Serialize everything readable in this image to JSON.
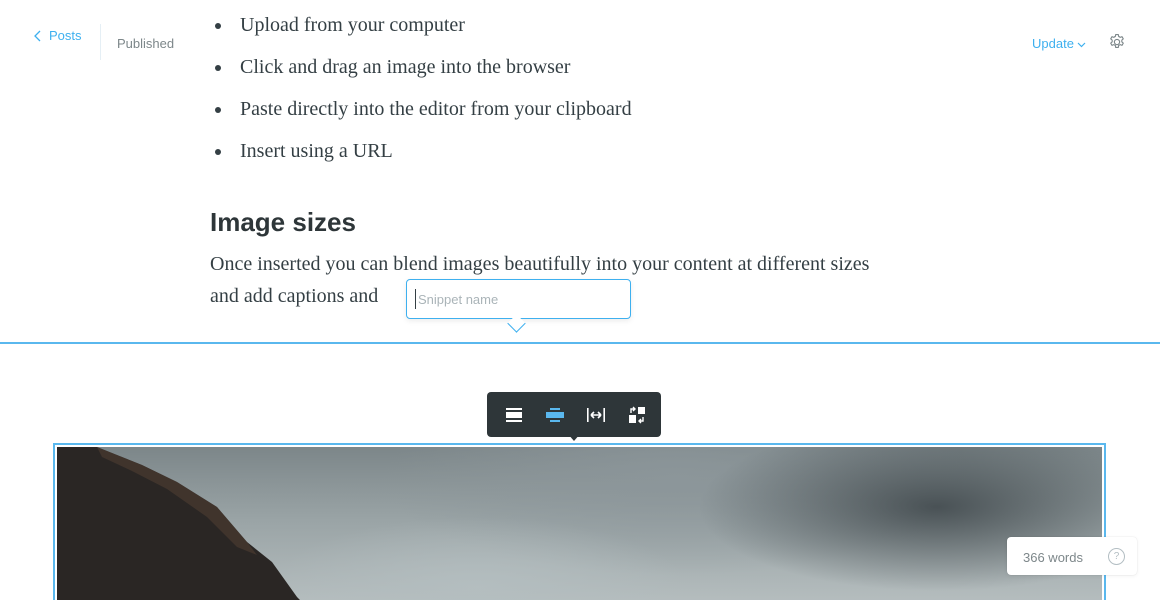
{
  "header": {
    "back_label": "Posts",
    "status": "Published",
    "update_label": "Update"
  },
  "editor": {
    "bullets": [
      "Upload from your computer",
      "Click and drag an image into the browser",
      "Paste directly into the editor from your clipboard",
      "Insert using a URL"
    ],
    "heading": "Image sizes",
    "paragraph_line1": "Once inserted you can blend images beautifully into your content at different sizes",
    "paragraph_line2": "and add captions and"
  },
  "snippet": {
    "placeholder": "Snippet name",
    "value": ""
  },
  "image_toolbar": {
    "buttons": [
      "regular-width-icon",
      "wide-width-icon",
      "full-width-icon",
      "replace-image-icon"
    ],
    "active_index": 1
  },
  "footer": {
    "word_count": "366 words",
    "help_label": "?"
  },
  "colors": {
    "accent": "#3eb0ef",
    "toolbar_bg": "#2e3639",
    "text": "#343f44",
    "muted": "#7d878a"
  }
}
